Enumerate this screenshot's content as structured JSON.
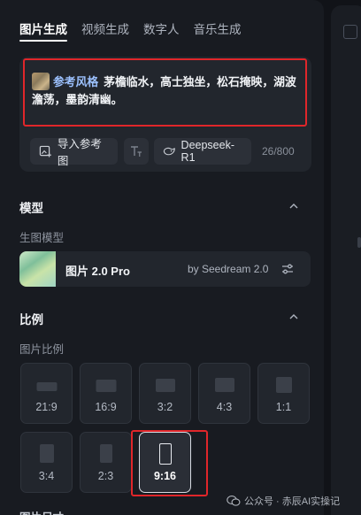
{
  "tabs": [
    {
      "label": "图片生成",
      "active": true
    },
    {
      "label": "视频生成",
      "active": false
    },
    {
      "label": "数字人",
      "active": false
    },
    {
      "label": "音乐生成",
      "active": false
    }
  ],
  "prompt": {
    "reference_label": "参考风格",
    "text": "茅檐临水，高士独坐，松石掩映，湖波澹荡，墨韵清幽。"
  },
  "toolbar": {
    "import_label": "导入参考图",
    "text_icon": "text-icon",
    "model_chip_label": "Deepseek-R1",
    "counter": "26/800"
  },
  "model_section": {
    "title": "模型",
    "sublabel": "生图模型",
    "model_name": "图片 2.0 Pro",
    "model_by": "by Seedream 2.0"
  },
  "ratio_section": {
    "title": "比例",
    "sublabel": "图片比例",
    "options": [
      {
        "label": "21:9",
        "selected": false
      },
      {
        "label": "16:9",
        "selected": false
      },
      {
        "label": "3:2",
        "selected": false
      },
      {
        "label": "4:3",
        "selected": false
      },
      {
        "label": "1:1",
        "selected": false
      },
      {
        "label": "3:4",
        "selected": false
      },
      {
        "label": "2:3",
        "selected": false
      },
      {
        "label": "9:16",
        "selected": true
      }
    ]
  },
  "footer_hint": "图片尺寸",
  "watermark": "公众号 · 赤辰AI实操记",
  "colors": {
    "panel": "#181b21",
    "card": "#22262d",
    "accent_link": "#9cc1ff",
    "annotation_red": "#e0262a"
  }
}
